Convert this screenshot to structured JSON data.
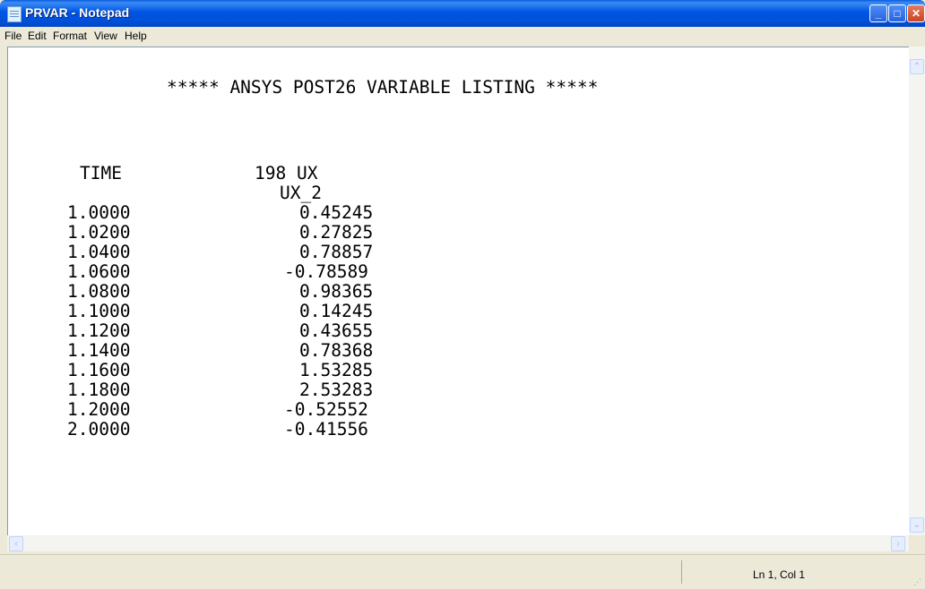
{
  "window": {
    "title": "PRVAR - Notepad"
  },
  "menu": {
    "file": "File",
    "edit": "Edit",
    "format": "Format",
    "view": "View",
    "help": "Help"
  },
  "document": {
    "header": "***** ANSYS POST26 VARIABLE LISTING *****",
    "col_time_label": "TIME",
    "col_var_label": "198 UX",
    "col_var_sublabel": "UX_2",
    "rows": [
      {
        "time": "1.0000",
        "value": "0.45245"
      },
      {
        "time": "1.0200",
        "value": "0.27825"
      },
      {
        "time": "1.0400",
        "value": "0.78857"
      },
      {
        "time": "1.0600",
        "value": "-0.78589"
      },
      {
        "time": "1.0800",
        "value": "0.98365"
      },
      {
        "time": "1.1000",
        "value": "0.14245"
      },
      {
        "time": "1.1200",
        "value": "0.43655"
      },
      {
        "time": "1.1400",
        "value": "0.78368"
      },
      {
        "time": "1.1600",
        "value": "1.53285"
      },
      {
        "time": "1.1800",
        "value": "2.53283"
      },
      {
        "time": "1.2000",
        "value": "-0.52552"
      },
      {
        "time": "2.0000",
        "value": "-0.41556"
      }
    ]
  },
  "status": {
    "position": "Ln 1, Col 1"
  }
}
